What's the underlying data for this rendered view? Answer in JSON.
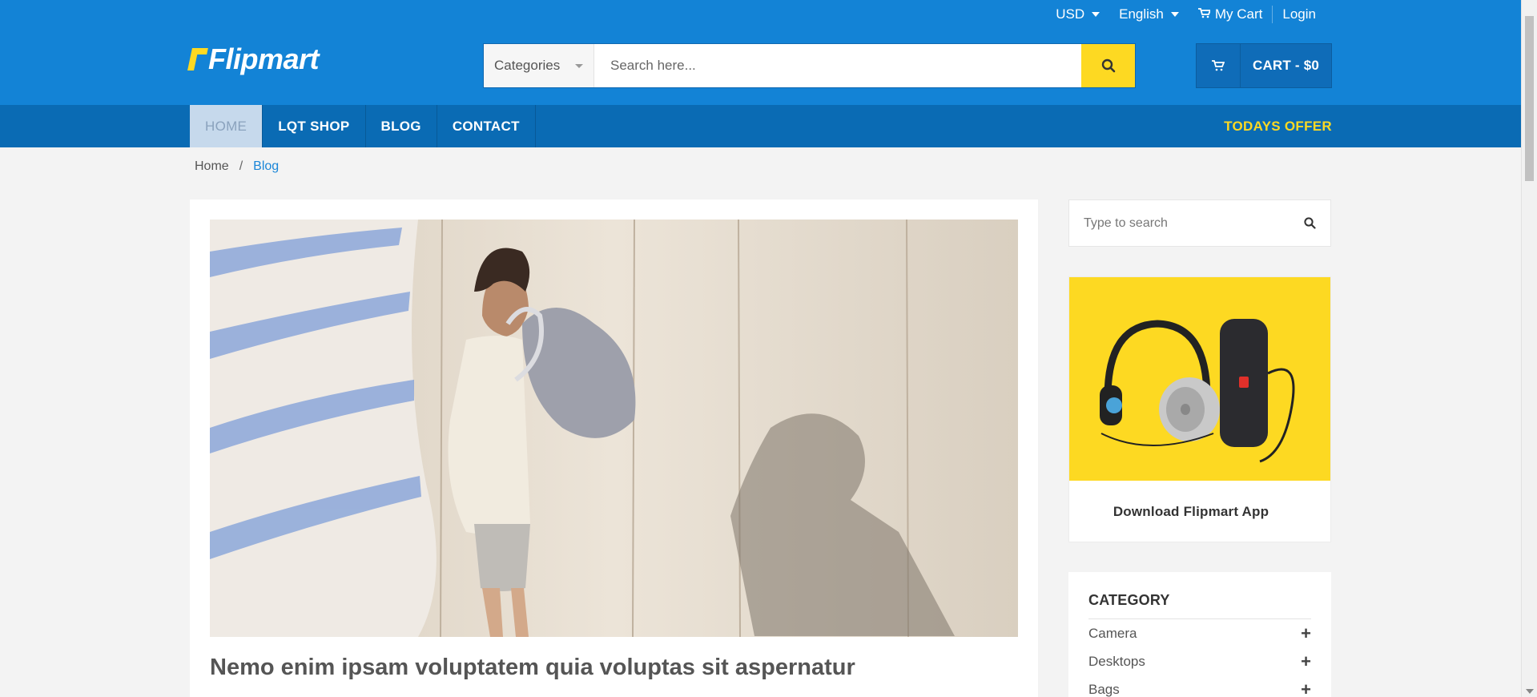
{
  "topbar": {
    "currency": "USD",
    "language": "English",
    "my_cart": "My Cart",
    "login": "Login"
  },
  "logo": {
    "text": "Flipmart"
  },
  "search": {
    "category_label": "Categories",
    "placeholder": "Search here..."
  },
  "cart": {
    "label": "CART - $0"
  },
  "nav": {
    "items": [
      {
        "label": "HOME",
        "active": true
      },
      {
        "label": "LQT SHOP"
      },
      {
        "label": "BLOG"
      },
      {
        "label": "CONTACT"
      }
    ],
    "todays_offer": "TODAYS OFFER"
  },
  "breadcrumb": {
    "home": "Home",
    "separator": "/",
    "current": "Blog"
  },
  "post": {
    "title": "Nemo enim ipsam voluptatem quia voluptas sit aspernatur"
  },
  "sidebar": {
    "search_placeholder": "Type to search",
    "promo_text": "Download Flipmart App",
    "category": {
      "title": "CATEGORY",
      "items": [
        "Camera",
        "Desktops",
        "Bags"
      ]
    }
  },
  "colors": {
    "header_blue": "#1383d6",
    "nav_blue": "#0a6bb4",
    "accent_yellow": "#fdd922",
    "link_blue": "#1a86d8"
  }
}
